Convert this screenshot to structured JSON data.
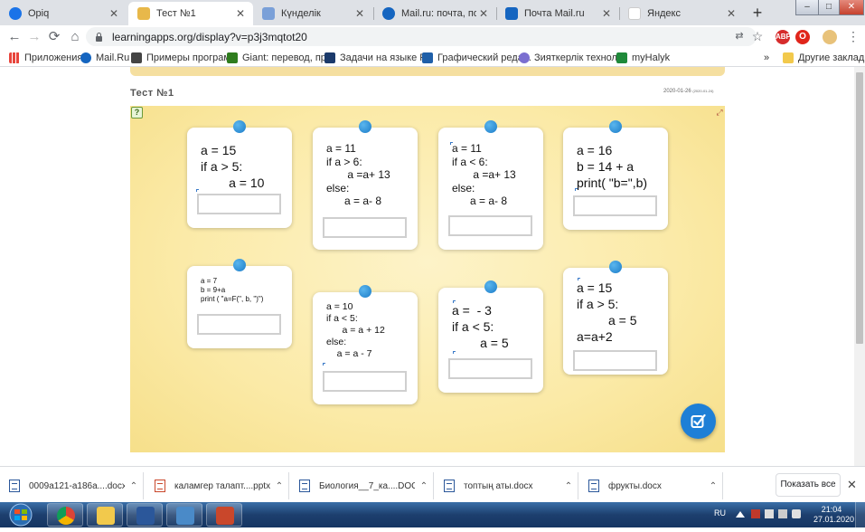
{
  "browser": {
    "tabs": [
      {
        "title": "Opiq",
        "color": "#1a73e8"
      },
      {
        "title": "Тест №1",
        "color": "#e8b84a",
        "active": true
      },
      {
        "title": "Күнделік",
        "color": "#7aa0d8"
      },
      {
        "title": "Mail.ru: почта, поиск в ...",
        "color": "#1565c0"
      },
      {
        "title": "Почта Mail.ru",
        "color": "#1565c0"
      },
      {
        "title": "Яндекс",
        "color": "#ffffff"
      }
    ],
    "close_glyph": "✕",
    "new_tab_glyph": "+",
    "window_buttons": [
      "–",
      "□",
      "✕"
    ],
    "url": "learningapps.org/display?v=p3j3mqtot20",
    "extensions": [
      {
        "label": "ABP",
        "color": "#d62c2c"
      },
      {
        "label": "O",
        "color": "#e0251b"
      }
    ]
  },
  "bookmarks": [
    {
      "label": "Приложения",
      "color": "#e8453c"
    },
    {
      "label": "Mail.Ru",
      "color": "#1565c0"
    },
    {
      "label": "Примеры программ",
      "color": "#444"
    },
    {
      "label": "Giant: перевод, пр...",
      "color": "#2f7d1e"
    },
    {
      "label": "Задачи на языке P...",
      "color": "#1b3a6b"
    },
    {
      "label": "Графический реда...",
      "color": "#1f5fa8"
    },
    {
      "label": "Зияткерлік технол...",
      "color": "#7b6fd0"
    },
    {
      "label": "myHalyk",
      "color": "#1f8a3a"
    }
  ],
  "bookmarks_more": "»",
  "bookmarks_other": "Другие закладки",
  "page": {
    "title": "Тест №1",
    "date": "2020-01-26",
    "date_small": "(2020-01-24)",
    "help_glyph": "?",
    "expand_glyph": "⤢"
  },
  "cards": [
    {
      "lines": [
        "a = 15",
        "if a > 5:",
        "        a = 10"
      ],
      "size": "big"
    },
    {
      "lines": [
        "a = 11",
        "if a > 6:",
        "       a =a+ 13",
        "else:",
        "      a = a- 8"
      ],
      "size": "mid"
    },
    {
      "lines": [
        "a = 11",
        "if a < 6:",
        "       a =a+ 13",
        "else:",
        "      a = a- 8"
      ],
      "size": "mid"
    },
    {
      "lines": [
        "a = 16",
        "b = 14 + a",
        "print( \"b=\",b)"
      ],
      "size": "big"
    },
    {
      "lines": [
        "a = 7",
        "b = 9+a",
        "print ( \"a=F(\", b, \")\")"
      ],
      "size": "small"
    },
    {
      "lines": [
        "a = 10",
        "if a < 5:",
        "      a = a + 12",
        "else:",
        "    a = a - 7"
      ],
      "size": "mid"
    },
    {
      "lines": [
        "a =  - 3",
        "if a < 5:",
        "        a = 5"
      ],
      "size": "big"
    },
    {
      "lines": [
        "a = 15",
        "if a > 5:",
        "         a = 5",
        "a=a+2"
      ],
      "size": "big"
    }
  ],
  "downloads": [
    {
      "name": "0009a121-a186a....docx",
      "type": "docx"
    },
    {
      "name": "каламгер талапт....pptx",
      "type": "pptx"
    },
    {
      "name": "Биология__7_ка....DOCX",
      "type": "docx"
    },
    {
      "name": "топтың аты.docx",
      "type": "docx"
    },
    {
      "name": "фрукты.docx",
      "type": "docx"
    }
  ],
  "show_all": "Показать все",
  "taskbar": {
    "lang": "RU",
    "time": "21:04",
    "date": "27.01.2020"
  }
}
